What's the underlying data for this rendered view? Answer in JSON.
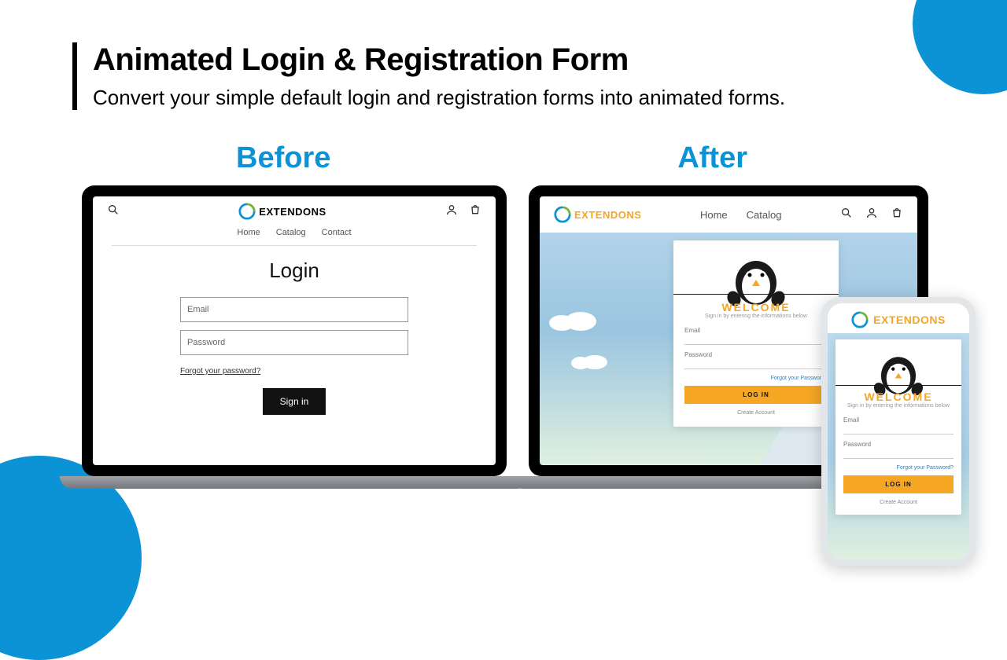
{
  "header": {
    "title": "Animated Login & Registration Form",
    "subtitle": "Convert your simple default login and registration forms into animated forms."
  },
  "labels": {
    "before": "Before",
    "after": "After"
  },
  "brand": {
    "name": "EXTENDONS",
    "name_prefix": "EXTEND",
    "name_suffix": "ONS"
  },
  "before_screen": {
    "nav": [
      "Home",
      "Catalog",
      "Contact"
    ],
    "title": "Login",
    "email_placeholder": "Email",
    "password_placeholder": "Password",
    "forgot": "Forgot your password?",
    "signin": "Sign in"
  },
  "after_screen": {
    "nav": [
      "Home",
      "Catalog"
    ],
    "welcome": "WELCOME",
    "subtext": "Sign in by entering the informations below",
    "email_label": "Email",
    "password_label": "Password",
    "forgot": "Forgot your Password?",
    "login": "LOG IN",
    "create": "Create Account"
  },
  "colors": {
    "accent_blue": "#0b93d6",
    "accent_orange": "#f5a623"
  }
}
